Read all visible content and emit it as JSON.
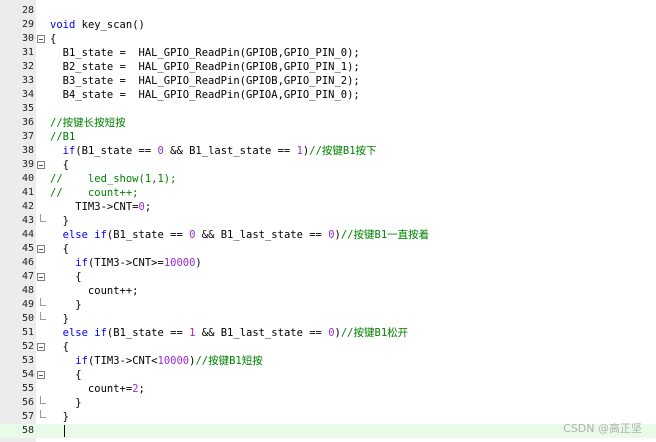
{
  "editor": {
    "lines": [
      {
        "no": "28",
        "tokens": []
      },
      {
        "no": "29",
        "tokens": [
          {
            "t": "kw",
            "v": "void"
          },
          {
            "t": "tx",
            "v": " key_scan()"
          }
        ]
      },
      {
        "no": "30",
        "fold": "open",
        "tokens": [
          {
            "t": "tx",
            "v": "{"
          }
        ]
      },
      {
        "no": "31",
        "tokens": [
          {
            "t": "tx",
            "v": "  B1_state =  HAL_GPIO_ReadPin(GPIOB,GPIO_PIN_0);"
          }
        ]
      },
      {
        "no": "32",
        "tokens": [
          {
            "t": "tx",
            "v": "  B2_state =  HAL_GPIO_ReadPin(GPIOB,GPIO_PIN_1);"
          }
        ]
      },
      {
        "no": "33",
        "tokens": [
          {
            "t": "tx",
            "v": "  B3_state =  HAL_GPIO_ReadPin(GPIOB,GPIO_PIN_2);"
          }
        ]
      },
      {
        "no": "34",
        "tokens": [
          {
            "t": "tx",
            "v": "  B4_state =  HAL_GPIO_ReadPin(GPIOA,GPIO_PIN_0);"
          }
        ]
      },
      {
        "no": "35",
        "tokens": []
      },
      {
        "no": "36",
        "tokens": [
          {
            "t": "cmt",
            "v": "//按键长按短按"
          }
        ]
      },
      {
        "no": "37",
        "tokens": [
          {
            "t": "cmt",
            "v": "//B1"
          }
        ]
      },
      {
        "no": "38",
        "tokens": [
          {
            "t": "tx",
            "v": "  "
          },
          {
            "t": "kw",
            "v": "if"
          },
          {
            "t": "tx",
            "v": "(B1_state == "
          },
          {
            "t": "num",
            "v": "0"
          },
          {
            "t": "tx",
            "v": " && B1_last_state == "
          },
          {
            "t": "num",
            "v": "1"
          },
          {
            "t": "tx",
            "v": ")"
          },
          {
            "t": "cmt",
            "v": "//按键B1按下"
          }
        ]
      },
      {
        "no": "39",
        "fold": "open",
        "tokens": [
          {
            "t": "tx",
            "v": "  {"
          }
        ]
      },
      {
        "no": "40",
        "tokens": [
          {
            "t": "cmt",
            "v": "//    led_show(1,1);"
          }
        ]
      },
      {
        "no": "41",
        "tokens": [
          {
            "t": "cmt",
            "v": "//    count++;"
          }
        ]
      },
      {
        "no": "42",
        "tokens": [
          {
            "t": "tx",
            "v": "    TIM3->CNT="
          },
          {
            "t": "num",
            "v": "0"
          },
          {
            "t": "tx",
            "v": ";"
          }
        ]
      },
      {
        "no": "43",
        "fold": "end",
        "tokens": [
          {
            "t": "tx",
            "v": "  }"
          }
        ]
      },
      {
        "no": "44",
        "tokens": [
          {
            "t": "tx",
            "v": "  "
          },
          {
            "t": "kw",
            "v": "else if"
          },
          {
            "t": "tx",
            "v": "(B1_state == "
          },
          {
            "t": "num",
            "v": "0"
          },
          {
            "t": "tx",
            "v": " && B1_last_state == "
          },
          {
            "t": "num",
            "v": "0"
          },
          {
            "t": "tx",
            "v": ")"
          },
          {
            "t": "cmt",
            "v": "//按键B1一直按着"
          }
        ]
      },
      {
        "no": "45",
        "fold": "open",
        "tokens": [
          {
            "t": "tx",
            "v": "  {"
          }
        ]
      },
      {
        "no": "46",
        "tokens": [
          {
            "t": "tx",
            "v": "    "
          },
          {
            "t": "kw",
            "v": "if"
          },
          {
            "t": "tx",
            "v": "(TIM3->CNT>="
          },
          {
            "t": "num",
            "v": "10000"
          },
          {
            "t": "tx",
            "v": ")"
          }
        ]
      },
      {
        "no": "47",
        "fold": "open",
        "tokens": [
          {
            "t": "tx",
            "v": "    {"
          }
        ]
      },
      {
        "no": "48",
        "tokens": [
          {
            "t": "tx",
            "v": "      count++;"
          }
        ]
      },
      {
        "no": "49",
        "fold": "end",
        "tokens": [
          {
            "t": "tx",
            "v": "    }"
          }
        ]
      },
      {
        "no": "50",
        "fold": "end",
        "tokens": [
          {
            "t": "tx",
            "v": "  }"
          }
        ]
      },
      {
        "no": "51",
        "tokens": [
          {
            "t": "tx",
            "v": "  "
          },
          {
            "t": "kw",
            "v": "else if"
          },
          {
            "t": "tx",
            "v": "(B1_state == "
          },
          {
            "t": "num",
            "v": "1"
          },
          {
            "t": "tx",
            "v": " && B1_last_state == "
          },
          {
            "t": "num",
            "v": "0"
          },
          {
            "t": "tx",
            "v": ")"
          },
          {
            "t": "cmt",
            "v": "//按键B1松开"
          }
        ]
      },
      {
        "no": "52",
        "fold": "open",
        "tokens": [
          {
            "t": "tx",
            "v": "  {"
          }
        ]
      },
      {
        "no": "53",
        "tokens": [
          {
            "t": "tx",
            "v": "    "
          },
          {
            "t": "kw",
            "v": "if"
          },
          {
            "t": "tx",
            "v": "(TIM3->CNT<"
          },
          {
            "t": "num",
            "v": "10000"
          },
          {
            "t": "tx",
            "v": ")"
          },
          {
            "t": "cmt",
            "v": "//按键B1短按"
          }
        ]
      },
      {
        "no": "54",
        "fold": "open",
        "tokens": [
          {
            "t": "tx",
            "v": "    {"
          }
        ]
      },
      {
        "no": "55",
        "tokens": [
          {
            "t": "tx",
            "v": "      count+="
          },
          {
            "t": "num",
            "v": "2"
          },
          {
            "t": "tx",
            "v": ";"
          }
        ]
      },
      {
        "no": "56",
        "fold": "end",
        "tokens": [
          {
            "t": "tx",
            "v": "    }"
          }
        ]
      },
      {
        "no": "57",
        "fold": "end",
        "tokens": [
          {
            "t": "tx",
            "v": "  }"
          }
        ]
      },
      {
        "no": "58",
        "current": true,
        "tokens": [
          {
            "t": "tx",
            "v": ""
          }
        ]
      }
    ]
  },
  "watermark": {
    "text": "CSDN @高正坚"
  },
  "colors": {
    "keyword": "#0000ff",
    "number": "#9b2bd6",
    "comment": "#008000",
    "current_line": "#e8fbe8",
    "gutter": "#ececec"
  }
}
